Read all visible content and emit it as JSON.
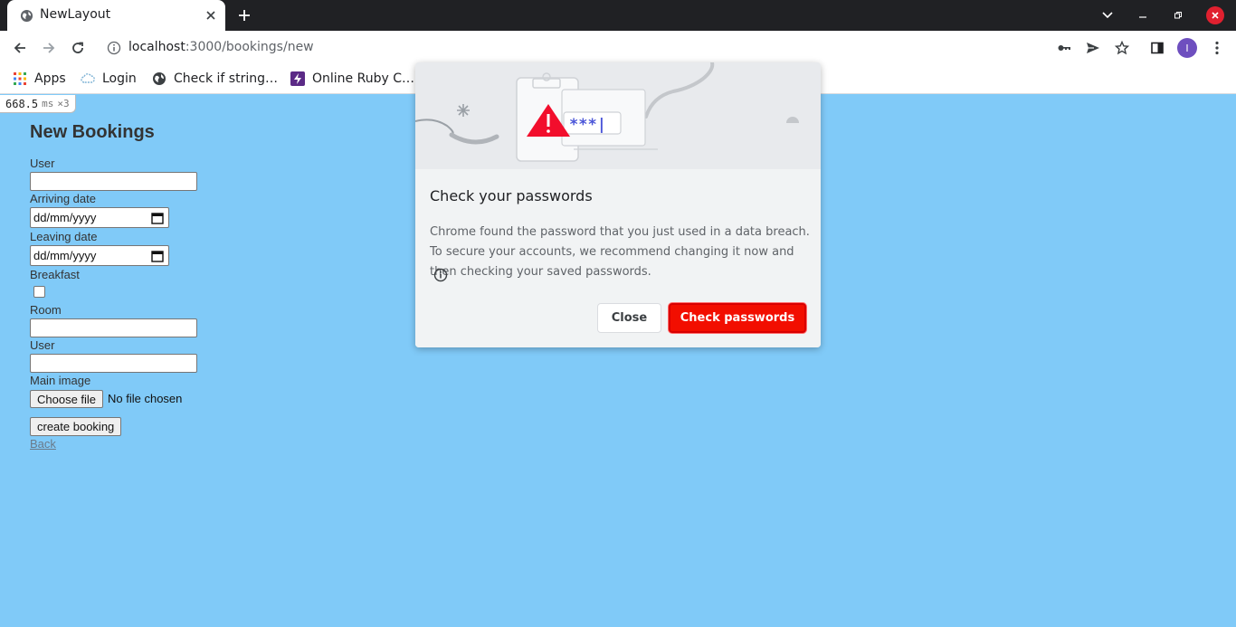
{
  "browser": {
    "tab_title": "NewLayout",
    "tab_close_icon": "close-icon",
    "new_tab_icon": "plus-icon",
    "url_host": "localhost",
    "url_path": ":3000/bookings/new",
    "profile_initial": "I",
    "profile_color": "#6e4fbf",
    "close_window_color": "#e0202f"
  },
  "bookmarks": [
    {
      "label": "Apps",
      "icon": "apps-grid-icon"
    },
    {
      "label": "Login",
      "icon": "cloud-icon"
    },
    {
      "label": "Check if string…",
      "icon": "globe-icon"
    },
    {
      "label": "Online Ruby C…",
      "icon": "bolt-icon"
    }
  ],
  "perf": {
    "value": "668.5",
    "unit": "ms",
    "count": "×3"
  },
  "form": {
    "title": "New Bookings",
    "user_label": "User",
    "arriving_label": "Arriving date",
    "arriving_placeholder": "dd/mm/yyyy",
    "leaving_label": "Leaving date",
    "leaving_placeholder": "dd/mm/yyyy",
    "breakfast_label": "Breakfast",
    "room_label": "Room",
    "user2_label": "User",
    "image_label": "Main image",
    "file_button": "Choose file",
    "file_status": "No file chosen",
    "submit": "create booking",
    "back": "Back"
  },
  "dialog": {
    "title": "Check your passwords",
    "body": "Chrome found the password that you just used in a data breach. To secure your accounts, we recommend changing it now and then checking your saved passwords.",
    "close": "Close",
    "confirm": "Check passwords",
    "masked": "***|",
    "accent": "#f20e00"
  }
}
